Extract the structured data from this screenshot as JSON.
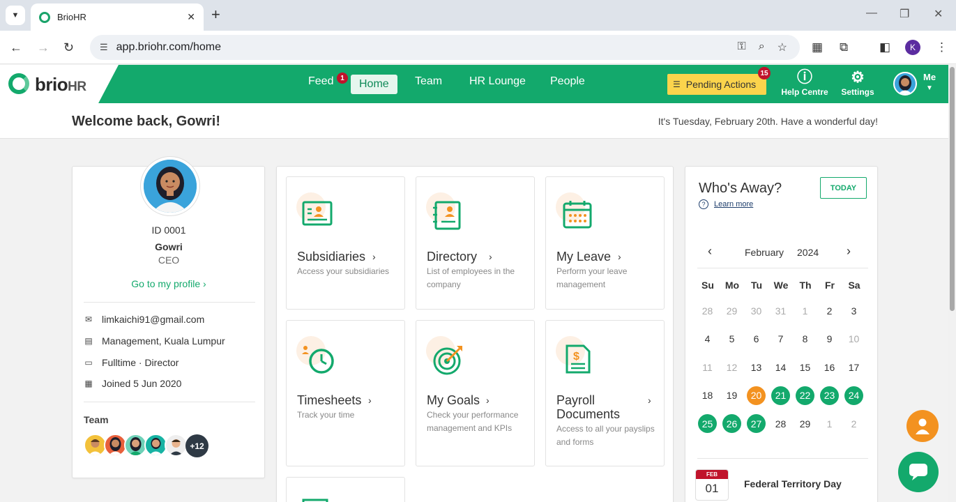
{
  "browser": {
    "tab_title": "BrioHR",
    "url": "app.briohr.com/home",
    "profile_initial": "K"
  },
  "header": {
    "logo_main": "brio",
    "logo_suffix": "HR",
    "nav": [
      {
        "label": "Feed",
        "badge": "1"
      },
      {
        "label": "Home"
      },
      {
        "label": "Team"
      },
      {
        "label": "HR Lounge"
      },
      {
        "label": "People"
      }
    ],
    "pending_label": "Pending Actions",
    "pending_badge": "15",
    "help_label": "Help Centre",
    "settings_label": "Settings",
    "me_label": "Me"
  },
  "welcome": {
    "title": "Welcome back, Gowri!",
    "date_text": "It's Tuesday, February 20th. Have a wonderful day!"
  },
  "profile": {
    "id": "ID 0001",
    "name": "Gowri",
    "role": "CEO",
    "profile_link": "Go to my profile",
    "email": "limkaichi91@gmail.com",
    "department": "Management, Kuala Lumpur",
    "employment": "Fulltime · Director",
    "joined": "Joined 5 Jun 2020",
    "team_label": "Team",
    "team_more": "+12"
  },
  "tiles": [
    {
      "title": "Subsidiaries",
      "desc": "Access your subsidiaries",
      "icon": "id-card-icon"
    },
    {
      "title": "Directory",
      "desc": "List of employees in the company",
      "icon": "directory-icon"
    },
    {
      "title": "My Leave",
      "desc": "Perform your leave management",
      "icon": "calendar-icon"
    },
    {
      "title": "Timesheets",
      "desc": "Track your time",
      "icon": "clock-icon"
    },
    {
      "title": "My Goals",
      "desc": "Check your performance management and KPIs",
      "icon": "target-icon"
    },
    {
      "title": "Payroll Documents",
      "desc": "Access to all your payslips and forms",
      "icon": "payslip-icon"
    }
  ],
  "whos_away": {
    "title": "Who's Away?",
    "today_btn": "TODAY",
    "learn_more": "Learn more",
    "month": "February",
    "year": "2024",
    "weekdays": [
      "Su",
      "Mo",
      "Tu",
      "We",
      "Th",
      "Fr",
      "Sa"
    ],
    "weeks": [
      [
        {
          "d": "28",
          "s": "muted"
        },
        {
          "d": "29",
          "s": "muted"
        },
        {
          "d": "30",
          "s": "muted"
        },
        {
          "d": "31",
          "s": "muted"
        },
        {
          "d": "1",
          "s": "muted"
        },
        {
          "d": "2",
          "s": ""
        },
        {
          "d": "3",
          "s": ""
        }
      ],
      [
        {
          "d": "4",
          "s": ""
        },
        {
          "d": "5",
          "s": ""
        },
        {
          "d": "6",
          "s": ""
        },
        {
          "d": "7",
          "s": ""
        },
        {
          "d": "8",
          "s": ""
        },
        {
          "d": "9",
          "s": ""
        },
        {
          "d": "10",
          "s": "muted"
        }
      ],
      [
        {
          "d": "11",
          "s": "muted"
        },
        {
          "d": "12",
          "s": "muted"
        },
        {
          "d": "13",
          "s": ""
        },
        {
          "d": "14",
          "s": ""
        },
        {
          "d": "15",
          "s": ""
        },
        {
          "d": "16",
          "s": ""
        },
        {
          "d": "17",
          "s": ""
        }
      ],
      [
        {
          "d": "18",
          "s": ""
        },
        {
          "d": "19",
          "s": ""
        },
        {
          "d": "20",
          "s": "today"
        },
        {
          "d": "21",
          "s": "away"
        },
        {
          "d": "22",
          "s": "away"
        },
        {
          "d": "23",
          "s": "away"
        },
        {
          "d": "24",
          "s": "away"
        }
      ],
      [
        {
          "d": "25",
          "s": "away"
        },
        {
          "d": "26",
          "s": "away"
        },
        {
          "d": "27",
          "s": "away"
        },
        {
          "d": "28",
          "s": ""
        },
        {
          "d": "29",
          "s": ""
        },
        {
          "d": "1",
          "s": "muted"
        },
        {
          "d": "2",
          "s": "muted"
        }
      ]
    ],
    "holiday": {
      "month": "FEB",
      "day": "01",
      "name": "Federal Territory Day"
    }
  },
  "colors": {
    "brand": "#13a96c",
    "accent": "#f39220",
    "pending": "#fbd44c",
    "badge": "#c0132b"
  }
}
